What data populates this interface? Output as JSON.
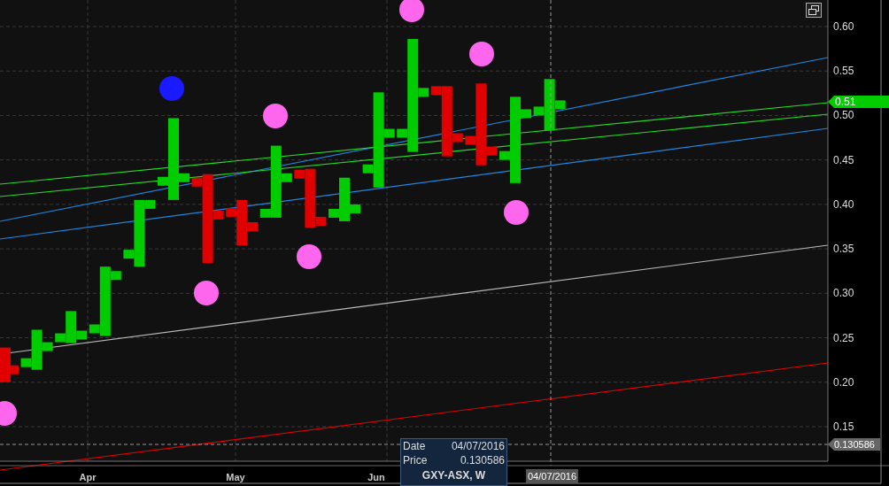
{
  "chart": {
    "y_axis_labels": [
      "0.60",
      "0.55",
      "0.50",
      "0.45",
      "0.40",
      "0.35",
      "0.30",
      "0.25",
      "0.20",
      "0.15"
    ],
    "x_axis_labels": [
      "Apr",
      "May",
      "Jun"
    ],
    "trend_lines": [
      {
        "color": "#1e88e5"
      },
      {
        "color": "#1e88e5"
      },
      {
        "color": "#22dd22"
      },
      {
        "color": "#22dd22"
      },
      {
        "color": "#bbbbbb"
      },
      {
        "color": "#e00000"
      }
    ],
    "signals": [
      {
        "color": "#ff66ee"
      },
      {
        "color": "#ff66ee"
      },
      {
        "color": "#ff66ee"
      },
      {
        "color": "#ff66ee"
      },
      {
        "color": "#ff66ee"
      },
      {
        "color": "#ff66ee"
      },
      {
        "color": "#ff66ee"
      },
      {
        "color": "#1a1aff"
      }
    ],
    "last_price": {
      "label": "0.51"
    },
    "crosshair": {
      "price_label": "0.130586",
      "date_label": "04/07/2016"
    }
  },
  "tooltip": {
    "rows": [
      {
        "label": "Date",
        "value": "04/07/2016"
      },
      {
        "label": "Price",
        "value": "0.130586"
      }
    ],
    "title": "GXY-ASX, W"
  }
}
